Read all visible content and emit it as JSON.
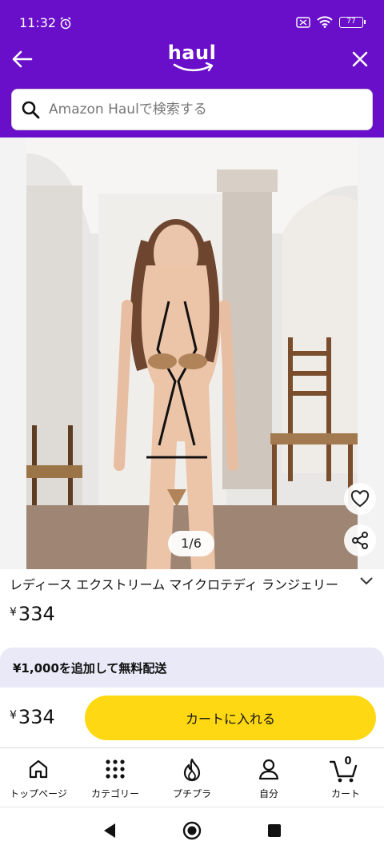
{
  "status_bar": {
    "time": "11:32",
    "battery": "77"
  },
  "header": {
    "logo_text": "haul"
  },
  "search": {
    "placeholder": "Amazon Haulで検索する"
  },
  "gallery": {
    "counter": "1/6"
  },
  "product": {
    "title": "レディース エクストリーム マイクロテディ ランジェリー",
    "price_symbol": "¥",
    "price": "334"
  },
  "shipping": {
    "message": "¥1,000を追加して無料配送"
  },
  "buybar": {
    "price_symbol": "¥",
    "price": "334",
    "cart_button": "カートに入れる"
  },
  "nav": {
    "items": [
      {
        "label": "トップページ",
        "icon": "home-icon"
      },
      {
        "label": "カテゴリー",
        "icon": "grid-icon"
      },
      {
        "label": "プチプラ",
        "icon": "flame-icon"
      },
      {
        "label": "自分",
        "icon": "person-icon"
      },
      {
        "label": "カート",
        "icon": "cart-icon"
      }
    ],
    "cart_count": "0"
  },
  "colors": {
    "header": "#6a0fc9",
    "cart_button": "#ffd814",
    "shipping_bg": "#e9e9f8"
  }
}
